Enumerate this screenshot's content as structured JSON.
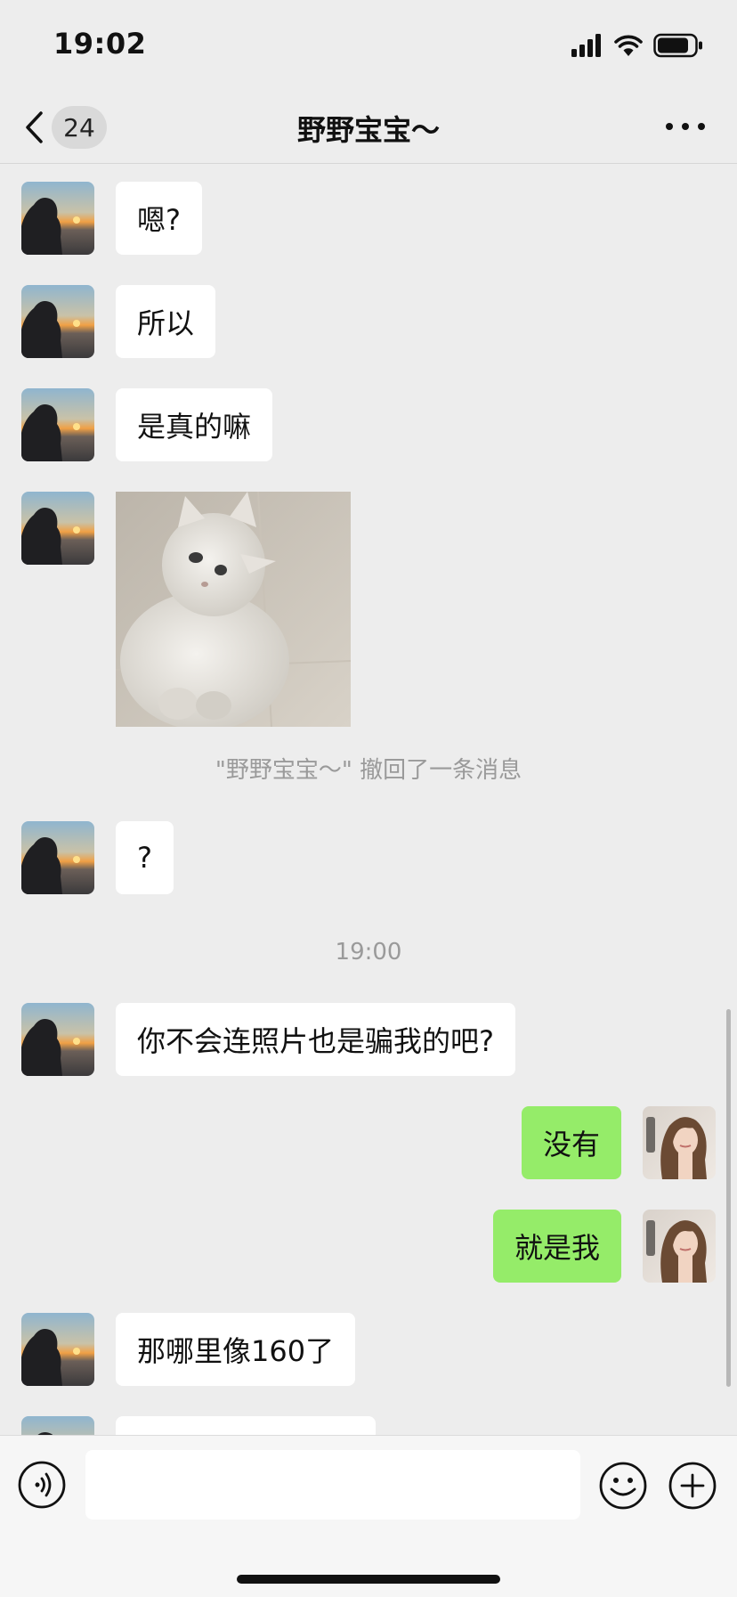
{
  "status_bar": {
    "time": "19:02"
  },
  "nav": {
    "unread_count": "24",
    "title": "野野宝宝～"
  },
  "messages": [
    {
      "text": "嗯?"
    },
    {
      "text": "所以"
    },
    {
      "text": "是真的嘛"
    },
    {
      "text": "?"
    },
    {
      "text": "你不会连照片也是骗我的吧?"
    },
    {
      "text": "没有"
    },
    {
      "text": "就是我"
    },
    {
      "text": "那哪里像160了"
    }
  ],
  "system": {
    "recall_notice": "\"野野宝宝～\" 撤回了一条消息",
    "timestamp": "19:00"
  },
  "input": {
    "placeholder": ""
  },
  "colors": {
    "background": "#ededed",
    "incoming_bubble": "#ffffff",
    "outgoing_bubble": "#95ec69",
    "system_text": "#9a9a9a"
  }
}
